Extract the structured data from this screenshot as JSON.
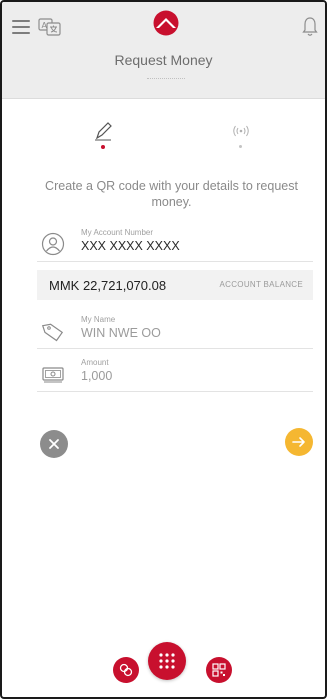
{
  "colors": {
    "accent": "#c8102e",
    "next_button": "#f5b731",
    "cancel_button": "#8c8c8c",
    "header_bg": "#ededed"
  },
  "header": {
    "title": "Request Money",
    "icons": [
      "hamburger-menu-icon",
      "translate-icon",
      "bank-logo",
      "bell-icon"
    ]
  },
  "tabs": [
    {
      "icon": "pencil-icon",
      "active": true
    },
    {
      "icon": "nfc-icon",
      "active": false
    }
  ],
  "main": {
    "subtitle": "Create a QR code with your details to request money.",
    "account": {
      "label": "My Account Number",
      "value": "XXX XXXX XXXX",
      "icon": "user-circle-icon"
    },
    "balance": {
      "amount": "MMK 22,721,070.08",
      "label": "ACCOUNT BALANCE"
    },
    "name": {
      "label": "My Name",
      "value": "WIN NWE OO",
      "icon": "tag-icon"
    },
    "amount": {
      "label": "Amount",
      "placeholder": "1,000",
      "icon": "cash-icon"
    }
  },
  "actions": {
    "cancel_icon": "close-icon",
    "next_icon": "arrow-right-icon"
  },
  "bottom_nav": {
    "left_icon": "transfer-icon",
    "center_icon": "grid-menu-icon",
    "right_icon": "qr-code-icon"
  }
}
